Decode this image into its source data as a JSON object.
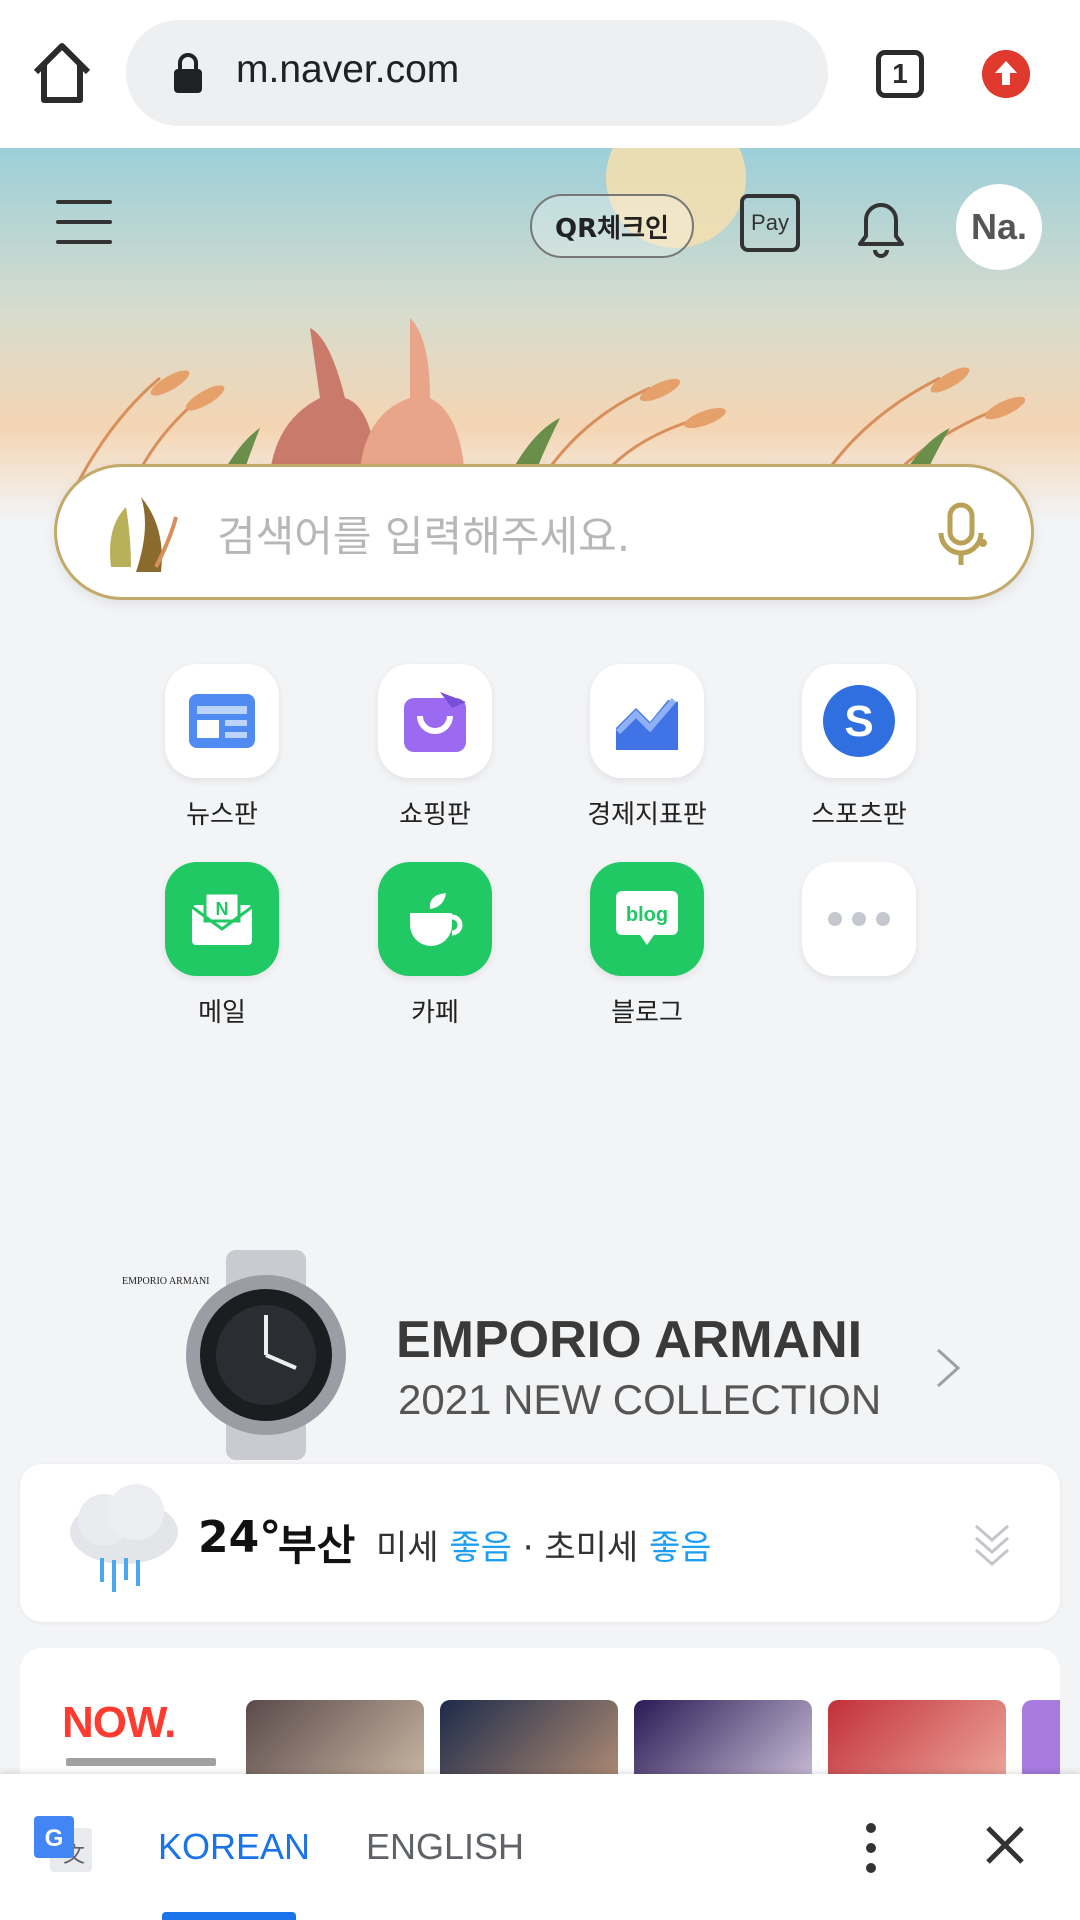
{
  "browser": {
    "url": "m.naver.com",
    "tab_count": "1"
  },
  "header": {
    "qr_label": "QR체크인",
    "pay_label": "Pay",
    "avatar_label": "Na."
  },
  "search": {
    "placeholder": "검색어를 입력해주세요."
  },
  "shortcuts": [
    {
      "label": "뉴스판",
      "icon": "news-icon"
    },
    {
      "label": "쇼핑판",
      "icon": "shopping-bag-icon"
    },
    {
      "label": "경제지표판",
      "icon": "chart-icon"
    },
    {
      "label": "스포츠판",
      "icon": "sports-icon"
    },
    {
      "label": "메일",
      "icon": "mail-icon"
    },
    {
      "label": "카페",
      "icon": "cafe-icon"
    },
    {
      "label": "블로그",
      "icon": "blog-icon"
    },
    {
      "label": "",
      "icon": "more-icon"
    }
  ],
  "ad": {
    "brand_small": "EMPORIO ARMANI",
    "title": "EMPORIO ARMANI",
    "subtitle": "2021 NEW COLLECTION"
  },
  "weather": {
    "temperature": "24°",
    "city": "부산",
    "fine_dust_label": "미세",
    "fine_dust_value": "좋음",
    "separator": "·",
    "ultra_fine_dust_label": "초미세",
    "ultra_fine_dust_value": "좋음"
  },
  "now": {
    "logo": "NOW."
  },
  "translate": {
    "source_lang": "KOREAN",
    "target_lang": "ENGLISH"
  },
  "colors": {
    "accent_green": "#20c964",
    "link_blue": "#1a73e8",
    "good_blue": "#1e9ef0",
    "now_red": "#ff3b30"
  }
}
